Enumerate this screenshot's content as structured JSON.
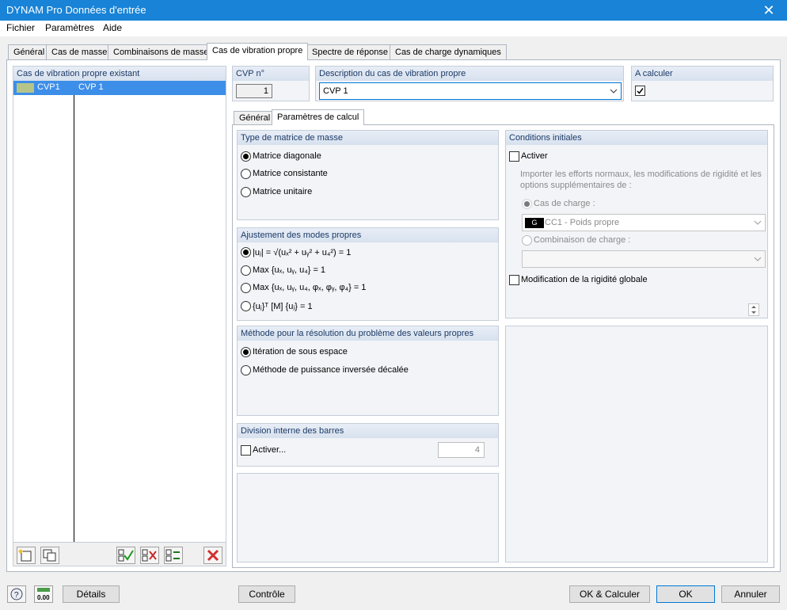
{
  "window": {
    "title": "DYNAM Pro Données d'entrée",
    "close_icon": "✕"
  },
  "menu": [
    "Fichier",
    "Paramètres",
    "Aide"
  ],
  "tabs": [
    "Général",
    "Cas de masse",
    "Combinaisons de masse",
    "Cas de vibration propre",
    "Spectre de réponse",
    "Cas de charge dynamiques"
  ],
  "left_panel": {
    "title": "Cas de vibration propre existant",
    "rows": [
      {
        "id": "CVP1",
        "name": "CVP 1",
        "selected": true,
        "color": "#b5c58a"
      }
    ]
  },
  "cvp_no": {
    "label": "CVP n°",
    "value": "1"
  },
  "description": {
    "label": "Description du cas de vibration propre",
    "value": "CVP 1"
  },
  "a_calculer": {
    "label": "A calculer",
    "checked": true
  },
  "subtabs": [
    "Général",
    "Paramètres de calcul"
  ],
  "mass_matrix": {
    "title": "Type de matrice de masse",
    "options": [
      "Matrice diagonale",
      "Matrice consistante",
      "Matrice unitaire"
    ],
    "selected": 0
  },
  "mode_adjust": {
    "title": "Ajustement des modes propres",
    "options": [
      "|uⱼ| = √(uₓ² + uᵧ² + u₄²) = 1",
      "Max {uₓ, uᵧ, u₄} = 1",
      "Max {uₓ, uᵧ, u₄, φₓ, φᵧ, φ₄} = 1",
      "{uⱼ}ᵀ [M] {uⱼ} = 1"
    ],
    "selected": 0
  },
  "method": {
    "title": "Méthode pour la résolution du problème des valeurs propres",
    "options": [
      "Itération de sous espace",
      "Méthode de puissance inversée décalée"
    ],
    "selected": 0
  },
  "division": {
    "title": "Division interne des barres",
    "activer": "Activer...",
    "value": "4"
  },
  "initial": {
    "title": "Conditions initiales",
    "activer": "Activer",
    "import_text": "Importer les efforts normaux, les modifications de rigidité et les options supplémentaires de :",
    "load_case_label": "Cas de charge :",
    "load_case_badge": "G",
    "load_case_value": "CC1 - Poids propre",
    "combo_label": "Combinaison de charge :",
    "rigidity_label": "Modification de la rigidité globale"
  },
  "footer": {
    "details": "Détails",
    "controle": "Contrôle",
    "ok_calc": "OK & Calculer",
    "ok": "OK",
    "annuler": "Annuler",
    "zero_label": "0.00"
  },
  "icons": {
    "help": "help-icon",
    "units": "units-icon",
    "new": "new-case-icon",
    "copy": "copy-case-icon",
    "check_all": "check-all-icon",
    "uncheck_all": "uncheck-all-icon",
    "toggle": "toggle-check-icon",
    "delete": "delete-icon"
  }
}
